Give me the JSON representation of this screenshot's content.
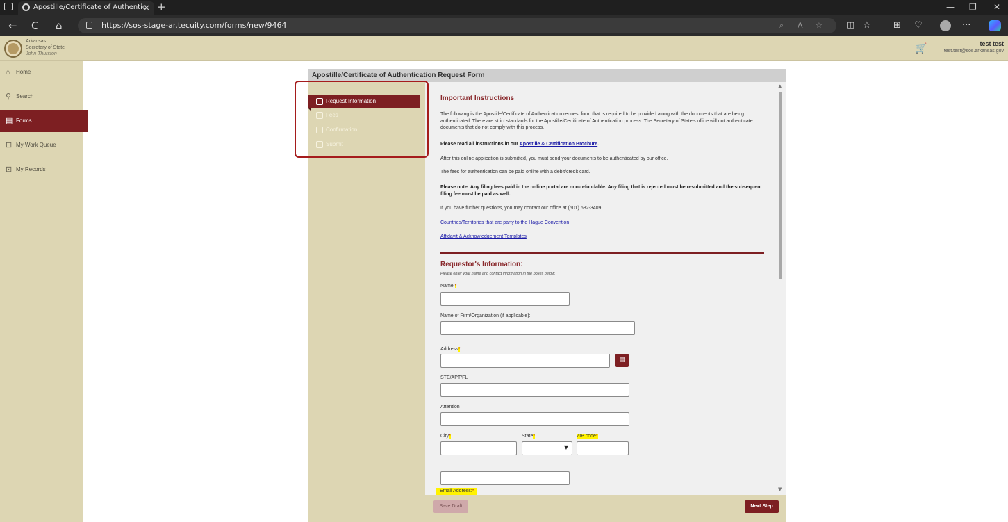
{
  "browser": {
    "tab_title": "Apostille/Certificate of Authentic",
    "tab_close": "×",
    "new_tab": "+",
    "url": "https://sos-stage-ar.tecuity.com/forms/new/9464",
    "nav_back": "←",
    "nav_refresh": "C",
    "nav_home": "⌂",
    "more": "···",
    "window_min": "—",
    "window_max": "❐",
    "window_close": "✕"
  },
  "header": {
    "brand_line1": "Arkansas",
    "brand_line2": "Secretary of State",
    "brand_name": "John Thurston",
    "user_name": "test test",
    "user_email": "test.test@sos.arkansas.gov"
  },
  "nav": {
    "items": [
      {
        "label": "Home",
        "icon": "home-icon"
      },
      {
        "label": "Search",
        "icon": "search-icon"
      },
      {
        "label": "Forms",
        "icon": "forms-icon",
        "active": true
      },
      {
        "label": "My Work Queue",
        "icon": "work-queue-icon"
      },
      {
        "label": "My Records",
        "icon": "records-icon"
      }
    ]
  },
  "form": {
    "title": "Apostille/Certificate of Authentication Request Form",
    "steps": [
      {
        "label": "Request Information",
        "active": true
      },
      {
        "label": "Fees",
        "active": false
      },
      {
        "label": "Confirmation",
        "active": false
      },
      {
        "label": "Submit",
        "active": false
      }
    ],
    "instructions": {
      "heading": "Important Instructions",
      "p1": "The following is the Apostille/Certificate of Authentication request form that is required to be provided along with the documents that are being authenticated. There are strict standards for the Apostille/Certificate of Authentication process. The Secretary of State's office will not authenticate documents that do not comply with this process.",
      "p2_prefix": "Please read all instructions in our ",
      "p2_link": "Apostille & Certification Brochure",
      "p2_suffix": ".",
      "p3": "After this online application is submitted, you must send your documents to be authenticated by our office.",
      "p4": "The fees for authentication can be paid online with a debit/credit card.",
      "p5": "Please note: Any filing fees paid in the online portal are non-refundable. Any filing that is rejected must be resubmitted and the subsequent filing fee must be paid as well.",
      "p6": "If you have further questions, you may contact our office at (501) 682-3409.",
      "link1": "Countries/Territories that are party to the Hague Convention",
      "link2": "Affidavit & Acknowledgement Templates"
    },
    "requestor": {
      "heading": "Requestor's Information:",
      "hint": "Please enter your name and contact information in the boxes below.",
      "name_label": "Name:",
      "firm_label": "Name of Firm/Organization (if applicable):",
      "address_label": "Address",
      "ste_label": "STE/APT/FL",
      "attention_label": "Attention",
      "city_label": "City",
      "state_label": "State",
      "zip_label": "ZIP code",
      "email_label": "Email Address:",
      "required_mark": "*",
      "name_value": "",
      "firm_value": "",
      "address_value": "",
      "ste_value": "",
      "attention_value": "",
      "city_value": "",
      "state_value": "",
      "zip_value": "",
      "email_value": ""
    },
    "buttons": {
      "save_draft": "Save Draft",
      "next_step": "Next Step"
    }
  },
  "colors": {
    "accent": "#7d1f22",
    "sidebar_bg": "#ddd6b3",
    "highlight": "#fff200",
    "annotation": "#a51c1c"
  }
}
